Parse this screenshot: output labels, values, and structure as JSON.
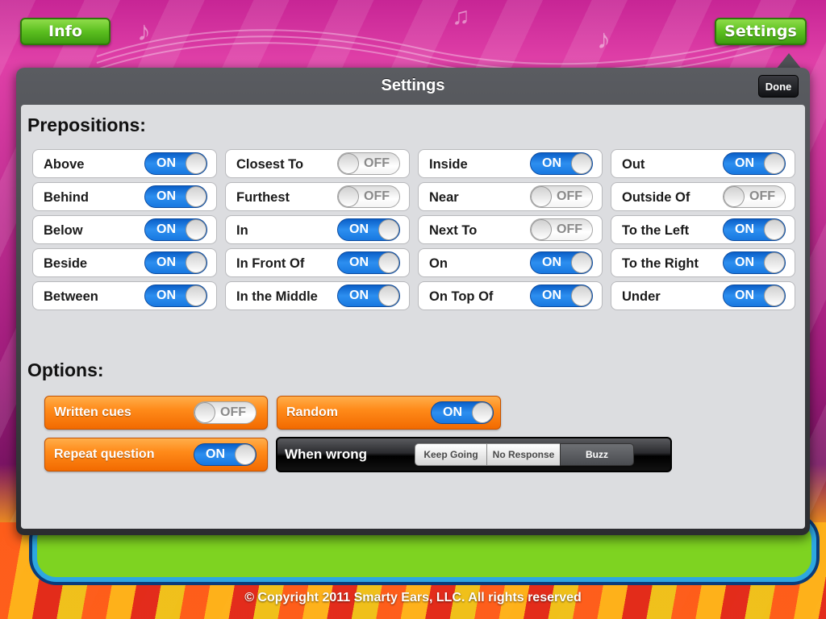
{
  "top_bar": {
    "info_label": "Info",
    "settings_label": "Settings"
  },
  "popover": {
    "title": "Settings",
    "done_label": "Done"
  },
  "prepositions": {
    "title": "Prepositions:",
    "items": [
      {
        "label": "Above",
        "state": "ON"
      },
      {
        "label": "Behind",
        "state": "ON"
      },
      {
        "label": "Below",
        "state": "ON"
      },
      {
        "label": "Beside",
        "state": "ON"
      },
      {
        "label": "Between",
        "state": "ON"
      },
      {
        "label": "Closest To",
        "state": "OFF"
      },
      {
        "label": "Furthest",
        "state": "OFF"
      },
      {
        "label": "In",
        "state": "ON"
      },
      {
        "label": "In Front Of",
        "state": "ON"
      },
      {
        "label": "In the Middle",
        "state": "ON"
      },
      {
        "label": "Inside",
        "state": "ON"
      },
      {
        "label": "Near",
        "state": "OFF"
      },
      {
        "label": "Next To",
        "state": "OFF"
      },
      {
        "label": "On",
        "state": "ON"
      },
      {
        "label": "On Top Of",
        "state": "ON"
      },
      {
        "label": "Out",
        "state": "ON"
      },
      {
        "label": "Outside Of",
        "state": "OFF"
      },
      {
        "label": "To the Left",
        "state": "ON"
      },
      {
        "label": "To the Right",
        "state": "ON"
      },
      {
        "label": "Under",
        "state": "ON"
      }
    ]
  },
  "options": {
    "title": "Options:",
    "written_cues": {
      "label": "Written cues",
      "state": "OFF"
    },
    "random": {
      "label": "Random",
      "state": "ON"
    },
    "repeat_question": {
      "label": "Repeat question",
      "state": "ON"
    },
    "when_wrong": {
      "label": "When wrong",
      "segments": [
        "Keep Going",
        "No Response",
        "Buzz"
      ],
      "selected": "Buzz"
    }
  },
  "footer": {
    "copyright": "© Copyright 2011 Smarty Ears, LLC.  All rights reserved"
  },
  "colors": {
    "accent_green": "#5cbf20",
    "switch_on_blue": "#1878e0",
    "option_orange": "#ff8b1a",
    "background_magenta": "#c2218f"
  }
}
